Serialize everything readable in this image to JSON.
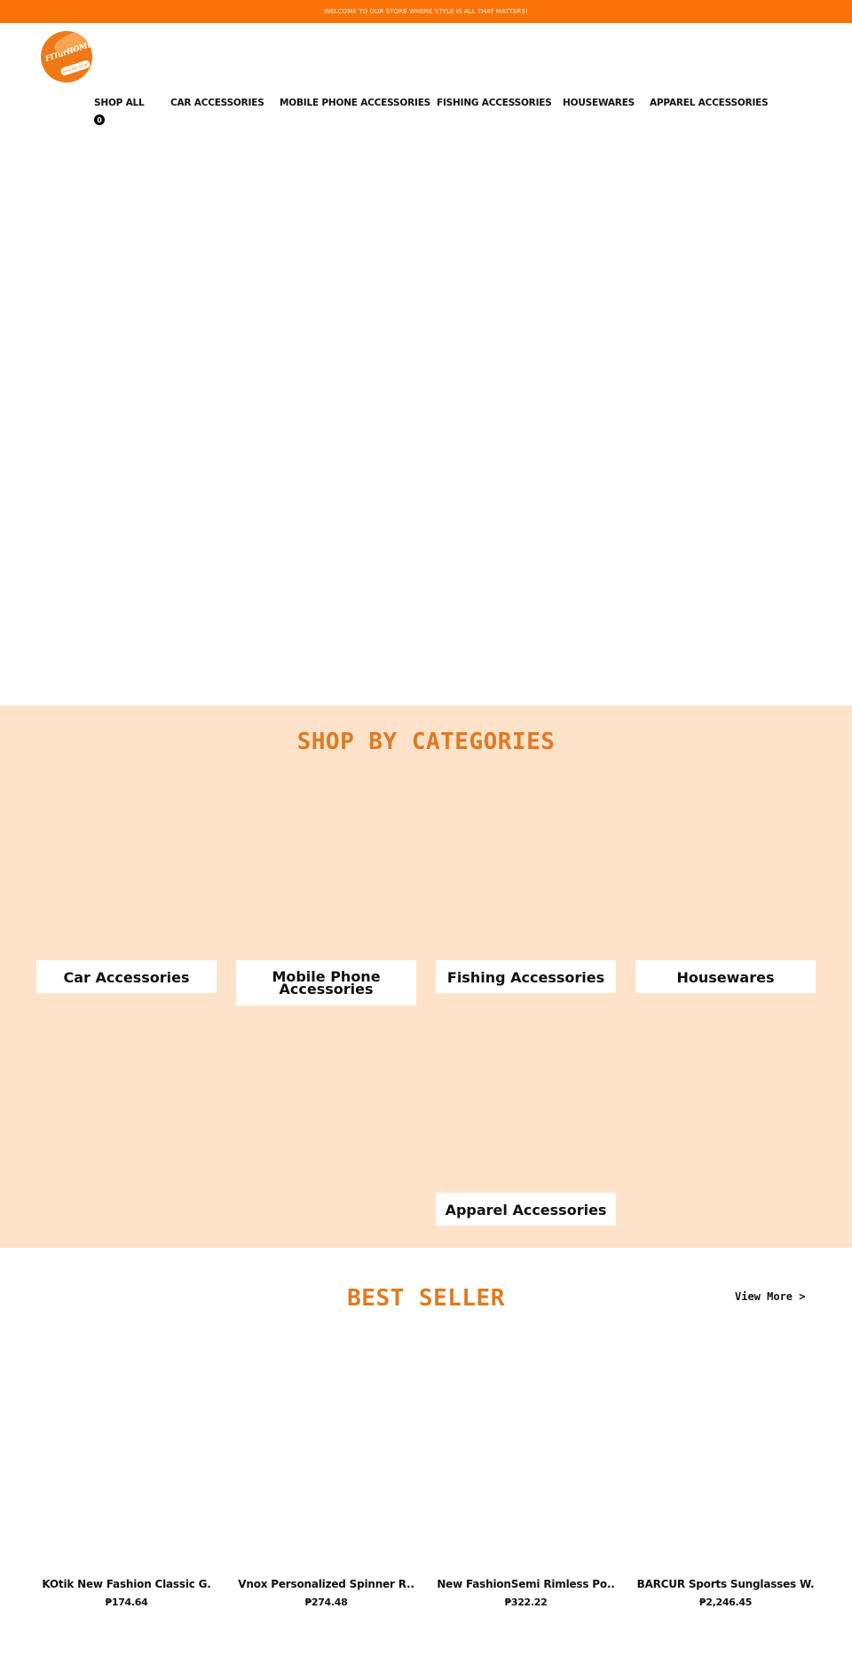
{
  "announcement": {
    "text": "WELCOME TO OUR STORE WHERE STYLE IS ALL THAT MATTERS!"
  },
  "logo": {
    "wordmark": "FITurHOME",
    "tagline": "Mind the Style!",
    "icon": "brand-logo-circle"
  },
  "nav": {
    "items": [
      {
        "label": "SHOP ALL"
      },
      {
        "label": "CAR ACCESSORIES"
      },
      {
        "label": "MOBILE PHONE ACCESSORIES"
      },
      {
        "label": "FISHING ACCESSORIES"
      },
      {
        "label": "HOUSEWARES"
      },
      {
        "label": "APPAREL ACCESSORIES"
      }
    ],
    "cart_count": "0"
  },
  "categories": {
    "title": "SHOP BY CATEGORIES",
    "items": [
      {
        "label": "Car Accessories"
      },
      {
        "label": "Mobile Phone Accessories"
      },
      {
        "label": "Fishing Accessories"
      },
      {
        "label": "Housewares"
      },
      {
        "label": "Apparel Accessories"
      }
    ]
  },
  "best_seller": {
    "title": "BEST SELLER",
    "view_more": "View More >",
    "products": [
      {
        "name": "KOtik New Fashion Classic G.",
        "price": "₱174.64"
      },
      {
        "name": "Vnox Personalized Spinner R..",
        "price": "₱274.48"
      },
      {
        "name": "New FashionSemi Rimless Po..",
        "price": "₱322.22"
      },
      {
        "name": "BARCUR Sports Sunglasses W.",
        "price": "₱2,246.45"
      }
    ]
  },
  "colors": {
    "announcement_bg": "#fb7306",
    "accent": "#e07a22",
    "categories_bg": "#fee3ca"
  }
}
